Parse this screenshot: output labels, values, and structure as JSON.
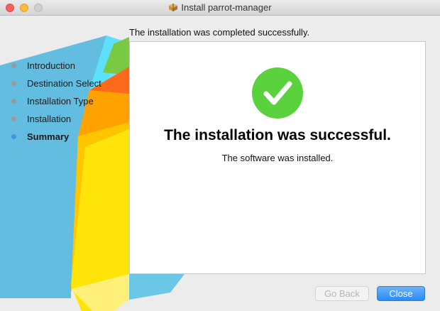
{
  "window": {
    "title": "Install parrot-manager",
    "title_icon": "package-icon"
  },
  "subtitle": "The installation was completed successfully.",
  "steps": [
    {
      "label": "Introduction",
      "active": false
    },
    {
      "label": "Destination Select",
      "active": false
    },
    {
      "label": "Installation Type",
      "active": false
    },
    {
      "label": "Installation",
      "active": false
    },
    {
      "label": "Summary",
      "active": true
    }
  ],
  "panel": {
    "icon": "checkmark-icon",
    "headline": "The installation was successful.",
    "message": "The software was installed."
  },
  "buttons": {
    "back": "Go Back",
    "close": "Close"
  },
  "colors": {
    "success": "#5ad23e",
    "accent": "#2a8af5",
    "active_step": "#4a90e2"
  }
}
